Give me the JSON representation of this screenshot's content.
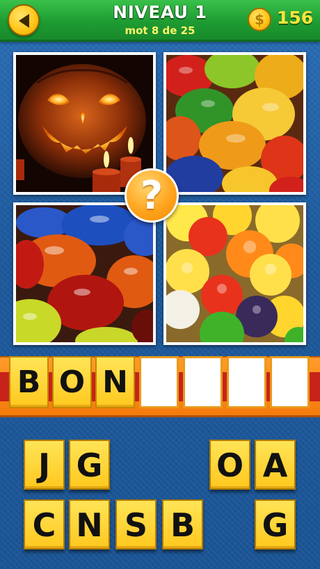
{
  "header": {
    "title": "NIVEAU 1",
    "subtitle": "mot 8 de 25",
    "coin_symbol": "$",
    "coins": "156",
    "back_icon": "back-arrow-icon"
  },
  "pictures": [
    {
      "subject": "jack-o-lantern-with-candles"
    },
    {
      "subject": "gummy-bears"
    },
    {
      "subject": "jelly-beans"
    },
    {
      "subject": "sugar-gumdrops"
    }
  ],
  "hint_symbol": "?",
  "answer": {
    "slots": [
      "B",
      "O",
      "N",
      "",
      "",
      "",
      ""
    ]
  },
  "letters": {
    "row1": [
      "J",
      "G",
      "O",
      "A"
    ],
    "row2": [
      "C",
      "N",
      "S",
      "B",
      "G"
    ]
  },
  "colors": {
    "header_green": "#1e9c32",
    "tile_yellow": "#ffc81e",
    "strip_orange": "#f57b0b",
    "hint_orange": "#ffa51f",
    "background_blue": "#1d5a9d"
  }
}
